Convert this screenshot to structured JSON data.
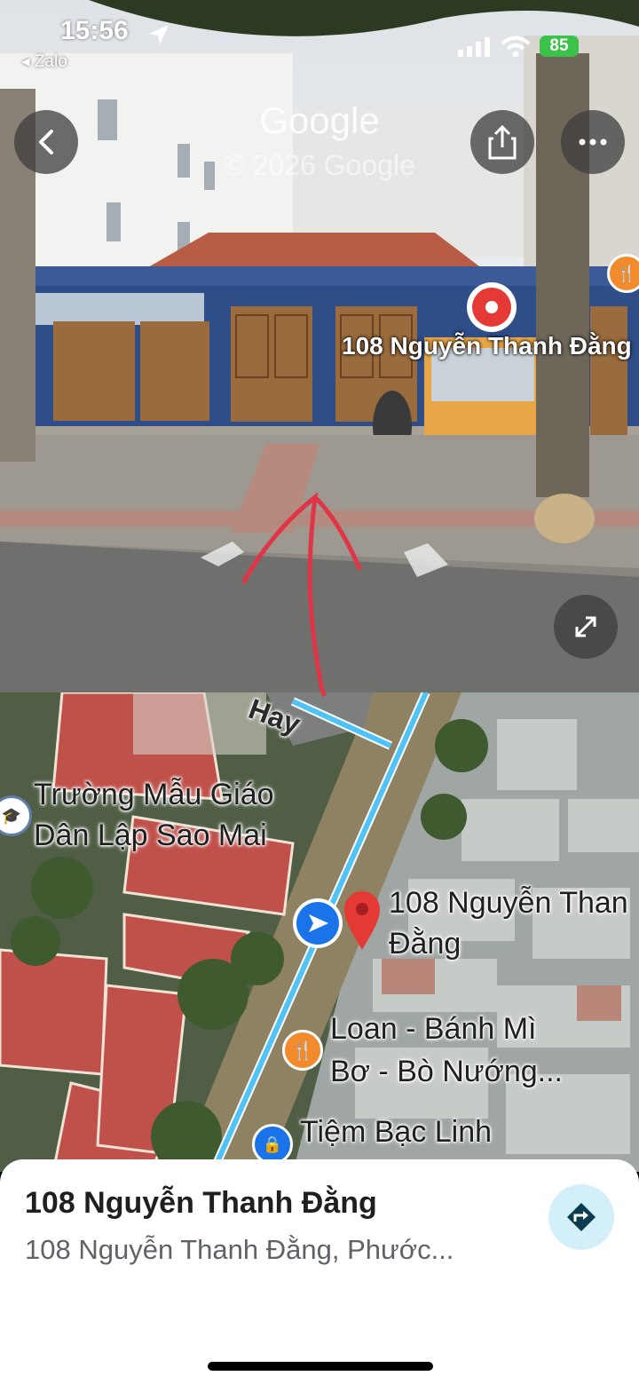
{
  "status_bar": {
    "time": "15:56",
    "back_app": "◂ Zalo",
    "battery": "85"
  },
  "street_view": {
    "watermark": "Google",
    "copyright": "© 2026 Google",
    "place_label": "108 Nguyễn Thanh Đằng",
    "icons": [
      "back-arrow-icon",
      "share-icon",
      "more-icon",
      "expand-icon",
      "restaurant-icon",
      "location-pin-icon"
    ]
  },
  "map": {
    "street_partial": "Hay",
    "school_line1": "Trường Mẫu Giáo",
    "school_line2": "Dân Lập Sao Mai",
    "pin_line1": "108 Nguyễn Than",
    "pin_line2": "Đằng",
    "restaurant_line1": "Loan - Bánh Mì",
    "restaurant_line2": "Bơ - Bò Nướng...",
    "shop_line1": "Tiệm Bạc Linh",
    "icons": [
      "school-icon",
      "navigation-arrow-icon",
      "map-pin-icon",
      "restaurant-icon",
      "shopping-icon"
    ]
  },
  "sheet": {
    "title": "108 Nguyễn Thanh Đằng",
    "subtitle": "108 Nguyễn Thanh Đằng, Phước...",
    "directions_icon": "directions-icon"
  },
  "colors": {
    "accent_blue": "#1a73e8",
    "route_cyan": "#4fc3f7",
    "pin_red": "#e53935",
    "poi_orange": "#f28b2c",
    "annotation_red": "#e03447",
    "battery_green": "#3cc24a"
  }
}
